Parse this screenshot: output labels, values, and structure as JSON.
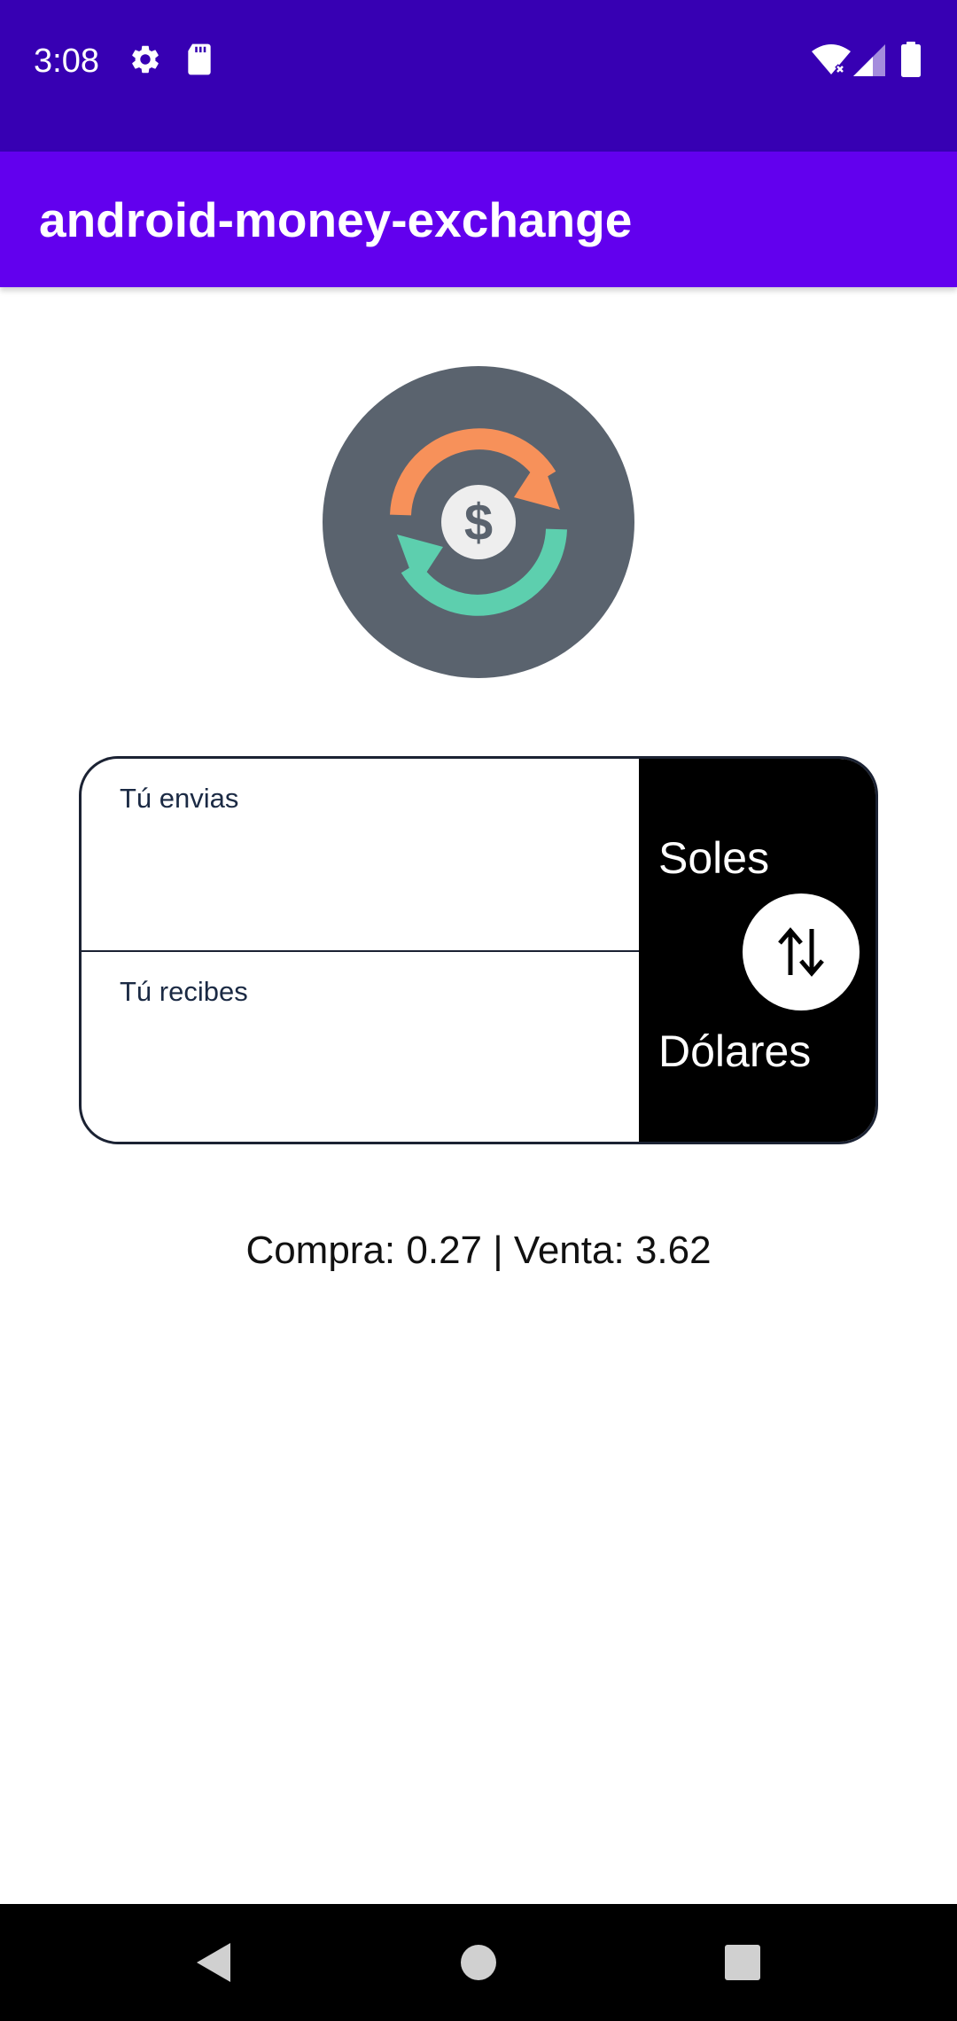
{
  "status_bar": {
    "time": "3:08",
    "icons": [
      "gear-icon",
      "sd-card-icon",
      "wifi-icon",
      "signal-icon",
      "battery-icon"
    ]
  },
  "app_bar": {
    "title": "android-money-exchange"
  },
  "logo": {
    "icon": "currency-exchange-icon",
    "symbol": "$",
    "colors": {
      "background": "#5a636e",
      "arrow_top": "#f7915a",
      "arrow_bottom": "#5dcfae",
      "coin": "#eeeeee"
    }
  },
  "converter": {
    "send_label": "Tú envias",
    "send_value": "",
    "receive_label": "Tú recibes",
    "receive_value": "",
    "from_currency": "Soles",
    "to_currency": "Dólares",
    "swap_icon": "swap-vertical-icon"
  },
  "rates": {
    "text": "Compra: 0.27 | Venta: 3.62"
  },
  "nav_bar": {
    "icons": [
      "back-icon",
      "home-icon",
      "recents-icon"
    ]
  },
  "colors": {
    "status_bar": "#3700b3",
    "app_bar": "#6200ee",
    "currency_panel": "#000000",
    "border": "#1b2233"
  }
}
